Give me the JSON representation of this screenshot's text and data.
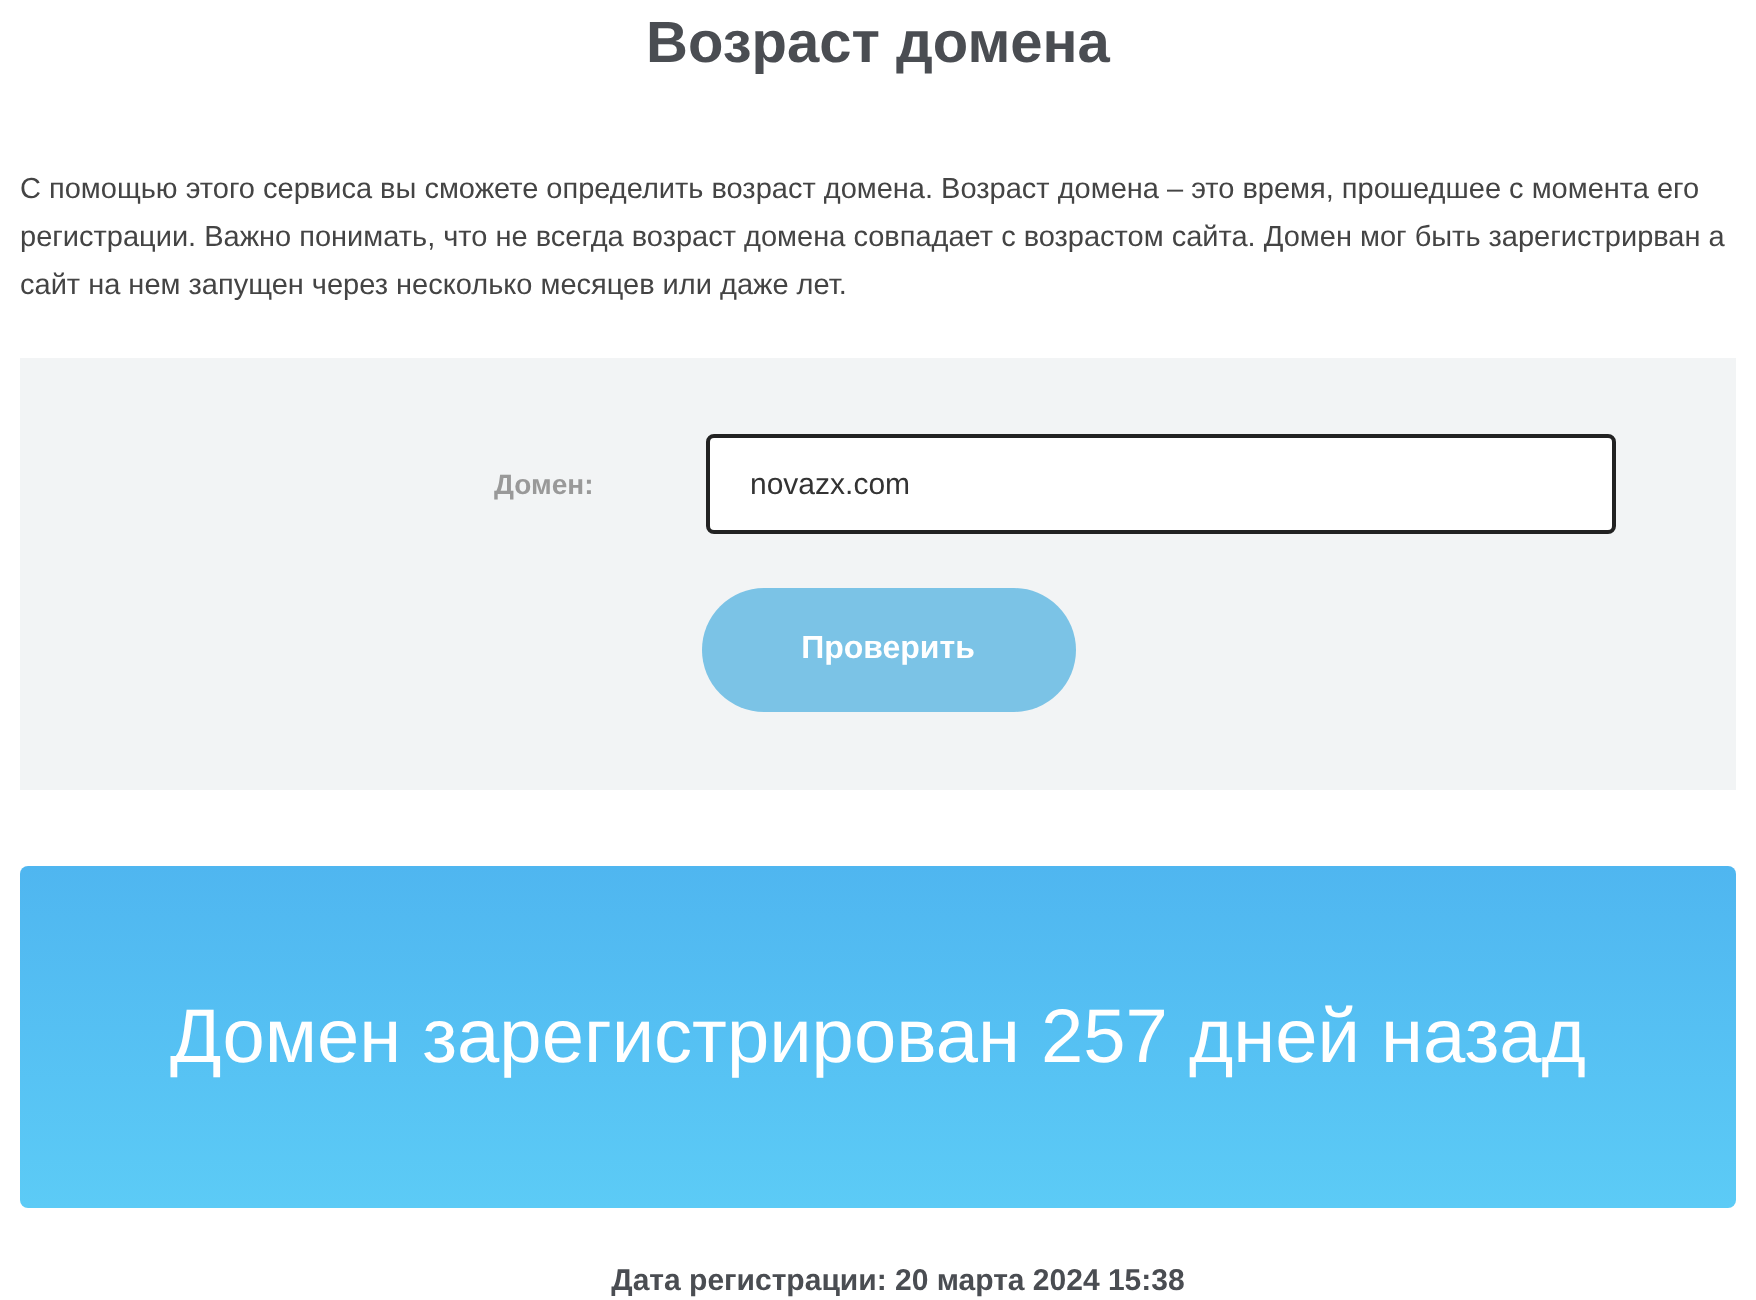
{
  "title": "Возраст домена",
  "description": "С помощью этого сервиса вы сможете определить возраст домена. Возраст домена – это время, прошедшее с момента его регистрации. Важно понимать, что не всегда возраст домена совпадает с возрастом сайта. Домен мог быть зарегистрирван а сайт на нем запущен через несколько месяцев или даже лет.",
  "form": {
    "label": "Домен:",
    "value": "novazx.com",
    "button": "Проверить"
  },
  "result": "Домен зарегистрирован 257 дней назад",
  "registration_date": "Дата регистрации: 20 марта 2024 15:38"
}
